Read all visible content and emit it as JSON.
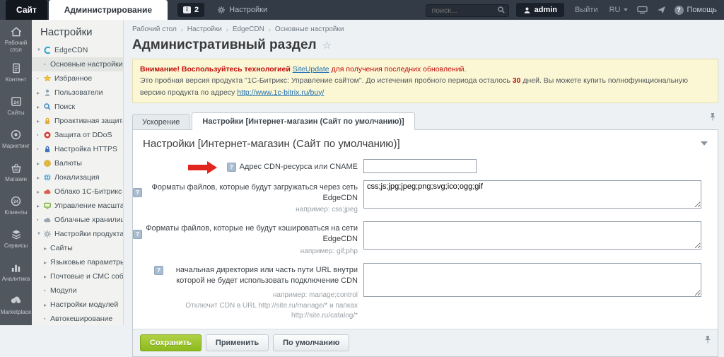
{
  "topbar": {
    "tab_site": "Сайт",
    "tab_admin": "Администрирование",
    "notifications_count": "2",
    "settings_label": "Настройки",
    "search_placeholder": "поиск...",
    "user": "admin",
    "logout": "Выйти",
    "lang": "RU",
    "help": "Помощь"
  },
  "sidebar": {
    "items": [
      {
        "label": "Рабочий стол"
      },
      {
        "label": "Контент"
      },
      {
        "label": "Сайты"
      },
      {
        "label": "Маркетинг"
      },
      {
        "label": "Магазин"
      },
      {
        "label": "Клиенты"
      },
      {
        "label": "Сервисы"
      },
      {
        "label": "Аналитика"
      },
      {
        "label": "Marketplace"
      }
    ]
  },
  "settings_menu": {
    "title": "Настройки",
    "items": [
      {
        "label": "EdgeCDN"
      },
      {
        "label": "Основные настройки"
      },
      {
        "label": "Избранное"
      },
      {
        "label": "Пользователи"
      },
      {
        "label": "Поиск"
      },
      {
        "label": "Проактивная защита"
      },
      {
        "label": "Защита от DDoS"
      },
      {
        "label": "Настройка HTTPS"
      },
      {
        "label": "Валюты"
      },
      {
        "label": "Локализация"
      },
      {
        "label": "Облако 1С-Битрикс"
      },
      {
        "label": "Управление масштабированием"
      },
      {
        "label": "Облачные хранилища"
      },
      {
        "label": "Настройки продукта"
      },
      {
        "label": "Сайты"
      },
      {
        "label": "Языковые параметры"
      },
      {
        "label": "Почтовые и СМС события"
      },
      {
        "label": "Модули"
      },
      {
        "label": "Настройки модулей"
      },
      {
        "label": "Автокеширование"
      }
    ]
  },
  "breadcrumb": [
    "Рабочий стол",
    "Настройки",
    "EdgeCDN",
    "Основные настройки"
  ],
  "page": {
    "title": "Административный раздел"
  },
  "notice": {
    "line1_prefix": "Внимание! Воспользуйтесь технологией ",
    "line1_link": "SiteUpdate",
    "line1_suffix": " для получения последних обновлений.",
    "line2_part1": "Это пробная версия продукта \"1С-Битрикс: Управление сайтом\". До истечения пробного периода осталось ",
    "line2_days": "30",
    "line2_part2": " дней. Вы можете купить полнофункциональную версию продукта по адресу ",
    "line2_link": "http://www.1c-bitrix.ru/buy/"
  },
  "tabs": {
    "inactive": "Ускорение",
    "active": "Настройки [Интернет-магазин (Сайт по умолчанию)]"
  },
  "form": {
    "heading": "Настройки [Интернет-магазин (Сайт по умолчанию)]",
    "rows": [
      {
        "label": "Адрес CDN-ресурса или CNAME",
        "value": ""
      },
      {
        "label": "Форматы файлов, которые будут загружаться через сеть EdgeCDN",
        "hint": "например: css;jpeg",
        "value": "css;js;jpg;jpeg;png;svg;ico;ogg;gif"
      },
      {
        "label": "Форматы файлов, которые не будут кэшироваться на сети EdgeCDN",
        "hint": "например: gif;php",
        "value": ""
      },
      {
        "label": "начальная директория или часть пути URL внутри которой не будет использовать подключение CDN",
        "hint": "например: manage;control",
        "hint2": "Отключит CDN в URL http://site.ru/manage/* и папках http://site.ru/catalog/*",
        "value": ""
      }
    ],
    "buttons": {
      "save": "Сохранить",
      "apply": "Применить",
      "default": "По умолчанию"
    }
  },
  "colors": {
    "accent_green": "#94c11f",
    "link_blue": "#1f6fb2",
    "warning_bg": "#fbf7d5",
    "warning_red": "#c00b0b",
    "arrow_red": "#e3261d",
    "topbar_bg": "#333b46"
  }
}
